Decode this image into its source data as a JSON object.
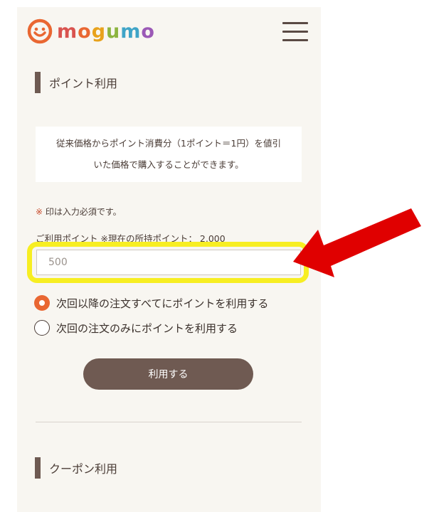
{
  "header": {
    "logo_text": [
      "m",
      "o",
      "g",
      "u",
      "m",
      "o"
    ],
    "logo_letter_colors": [
      "#d9534f",
      "#e96732",
      "#e8a21c",
      "#8cb43f",
      "#3fa4c7",
      "#9b59b6"
    ],
    "logo_mark_color": "#e96732",
    "logo_mark_icon": "smiley-face-icon",
    "menu_icon": "hamburger-menu-icon"
  },
  "points_section": {
    "title": "ポイント利用",
    "info_line1": "従来価格からポイント消費分（1ポイント＝1円）を値引",
    "info_line2": "いた価格で購入することができます。",
    "required_mark": "※",
    "required_note": " 印は入力必須です。",
    "points_label": "ご利用ポイント ※現在の所持ポイント： 2,000",
    "input_placeholder": "500",
    "input_value": ""
  },
  "options": [
    {
      "label": "次回以降の注文すべてにポイントを利用する",
      "checked": true
    },
    {
      "label": "次回の注文のみにポイントを利用する",
      "checked": false
    }
  ],
  "submit_label": "利用する",
  "coupon_section": {
    "title": "クーポン利用"
  },
  "colors": {
    "accent": "#e96732",
    "button": "#6f5a52",
    "highlight": "#f7ee22",
    "annotation_arrow": "#e00000"
  }
}
